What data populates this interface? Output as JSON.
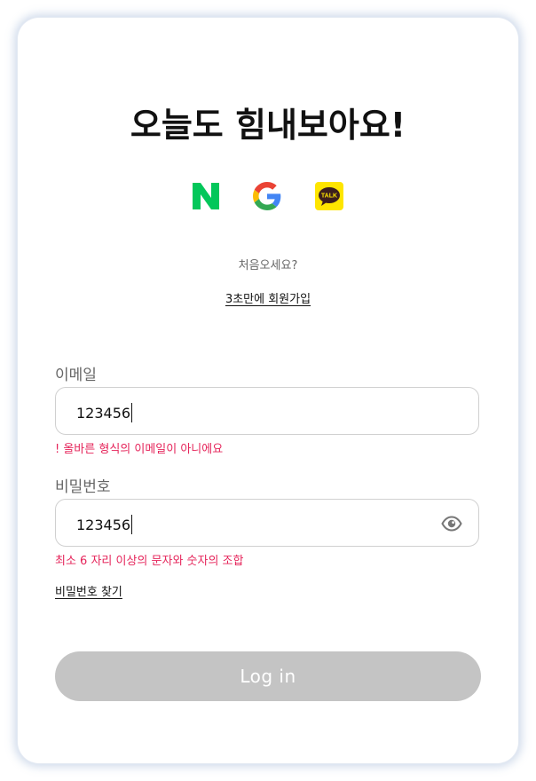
{
  "header": {
    "title": "오늘도 힘내보아요!"
  },
  "social_login": {
    "buttons": [
      {
        "name": "naver",
        "icon": "naver-icon",
        "color": "#03C75A"
      },
      {
        "name": "google",
        "icon": "google-icon",
        "colors": [
          "#4285F4",
          "#EA4335",
          "#FBBC05",
          "#34A853"
        ]
      },
      {
        "name": "kakao",
        "icon": "kakao-talk-icon",
        "color": "#FEE500",
        "label": "TALK"
      }
    ]
  },
  "signup": {
    "prompt": "처음오세요?",
    "link_label": "3초만에 회원가입"
  },
  "form": {
    "email": {
      "label": "이메일",
      "value": "123456",
      "error": "! 올바른 형식의 이메일이 아니에요"
    },
    "password": {
      "label": "비밀번호",
      "value": "123456",
      "error": "최소 6 자리 이상의 문자와 숫자의 조합",
      "toggle_icon": "eye-icon"
    },
    "find_password_label": "비밀번호 찾기",
    "submit_label": "Log in"
  },
  "colors": {
    "error": "#e5245a",
    "button_disabled": "#c4c4c4"
  }
}
